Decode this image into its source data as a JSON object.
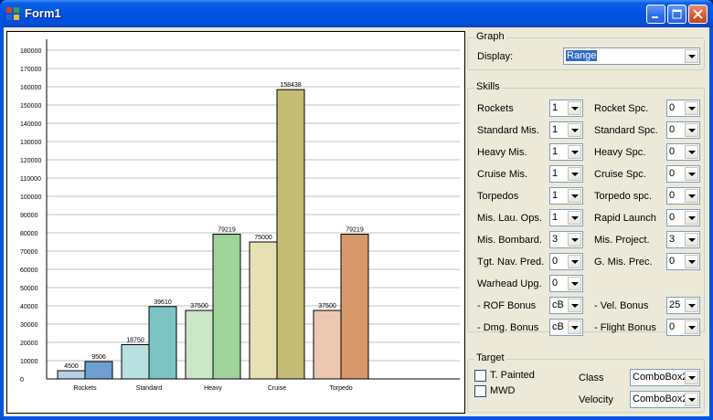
{
  "window": {
    "title": "Form1"
  },
  "chart_data": {
    "type": "bar",
    "categories": [
      "Rockets",
      "Standard",
      "Heavy",
      "Cruise",
      "Torpedo"
    ],
    "series": [
      {
        "values": [
          4500,
          18750,
          37500,
          75000,
          37500
        ]
      },
      {
        "values": [
          9506,
          39610,
          79219,
          158438,
          79219
        ]
      }
    ],
    "data_labels": [
      [
        "4500",
        "9506"
      ],
      [
        "18750",
        "39610"
      ],
      [
        "37500",
        "79219"
      ],
      [
        "75000",
        "158438"
      ],
      [
        "37500",
        "79219"
      ]
    ],
    "colors": [
      [
        "#b8cfe8",
        "#6d9fd3"
      ],
      [
        "#b8e0e0",
        "#7cc4c4"
      ],
      [
        "#cce6c8",
        "#9ed39a"
      ],
      [
        "#e6e0b4",
        "#c4bc72"
      ],
      [
        "#ecc8b2",
        "#d8986a"
      ]
    ],
    "ylim": [
      0,
      180000
    ],
    "yticks": [
      "0",
      "10000",
      "20000",
      "30000",
      "40000",
      "50000",
      "60000",
      "70000",
      "80000",
      "90000",
      "100000",
      "110000",
      "120000",
      "130000",
      "140000",
      "150000",
      "160000",
      "170000",
      "180000"
    ],
    "grid": true
  },
  "graph": {
    "legend": "Graph",
    "display_label": "Display:",
    "display_value": "Range"
  },
  "skills": {
    "legend": "Skills",
    "left": [
      {
        "label": "Rockets",
        "value": "1"
      },
      {
        "label": "Standard Mis.",
        "value": "1"
      },
      {
        "label": "Heavy Mis.",
        "value": "1"
      },
      {
        "label": "Cruise Mis.",
        "value": "1"
      },
      {
        "label": "Torpedos",
        "value": "1"
      },
      {
        "label": "Mis. Lau. Ops.",
        "value": "1"
      },
      {
        "label": "Mis. Bombard.",
        "value": "3"
      },
      {
        "label": "Tgt. Nav. Pred.",
        "value": "0"
      },
      {
        "label": "Warhead Upg.",
        "value": "0"
      },
      {
        "label": "- ROF Bonus",
        "value": "cB"
      },
      {
        "label": "- Dmg. Bonus",
        "value": "cB"
      }
    ],
    "right": [
      {
        "label": "Rocket Spc.",
        "value": "0"
      },
      {
        "label": "Standard Spc.",
        "value": "0"
      },
      {
        "label": "Heavy Spc.",
        "value": "0"
      },
      {
        "label": "Cruise Spc.",
        "value": "0"
      },
      {
        "label": "Torpedo spc.",
        "value": "0"
      },
      {
        "label": "Rapid Launch",
        "value": "0"
      },
      {
        "label": "Mis. Project.",
        "value": "3"
      },
      {
        "label": "G. Mis. Prec.",
        "value": "0"
      },
      {
        "label": "- Vel. Bonus",
        "value": "25"
      },
      {
        "label": "- Flight Bonus",
        "value": "0"
      }
    ]
  },
  "target": {
    "legend": "Target",
    "t_painted": "T. Painted",
    "mwd": "MWD",
    "class_label": "Class",
    "class_value": "ComboBox2",
    "velocity_label": "Velocity",
    "velocity_value": "ComboBox2"
  }
}
